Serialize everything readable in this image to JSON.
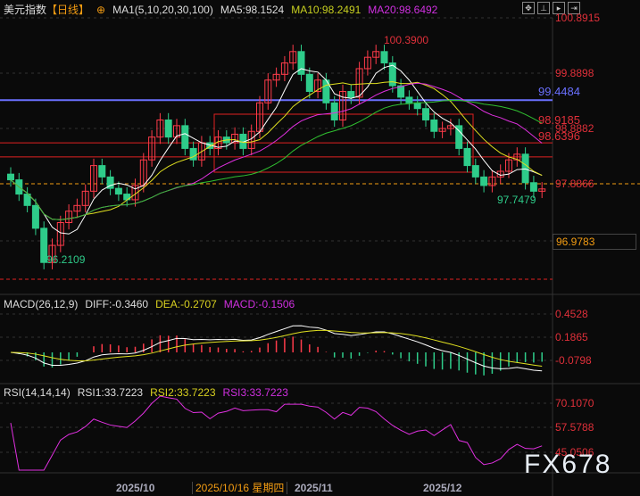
{
  "header": {
    "title": "美元指数",
    "period": "【日线】",
    "ma_label": "MA1(5,10,20,30,100)",
    "ma5": "MA5:98.1524",
    "ma10": "MA10:98.2491",
    "ma20": "MA20:98.6492"
  },
  "macd_header": {
    "label": "MACD(26,12,9)",
    "diff": "DIFF:-0.3460",
    "dea": "DEA:-0.2707",
    "macd": "MACD:-0.1506"
  },
  "rsi_header": {
    "label": "RSI(14,14,14)",
    "rsi1": "RSI1:33.7223",
    "rsi2": "RSI2:33.7223",
    "rsi3": "RSI3:33.7223"
  },
  "price_axis": [
    "100.8915",
    "99.8898",
    "98.8882",
    "97.8866",
    "96.9783"
  ],
  "macd_axis": [
    "0.4528",
    "0.1865",
    "-0.0798"
  ],
  "rsi_axis": [
    "70.1070",
    "57.5788",
    "45.0506"
  ],
  "x_axis": [
    "2025/10",
    "2025/11",
    "2025/12"
  ],
  "crosshair_date": "2025/10/16 星期四",
  "annotations": {
    "high": "100.3900",
    "low": "96.2109",
    "recent_low": "97.7479",
    "blue_line": "99.4484",
    "red_line1": "98.9185",
    "red_line2": "98.6396"
  },
  "levels": {
    "blue": 99.4484,
    "red1": 98.9185,
    "red2": 98.6396,
    "current": 97.8866
  },
  "watermark": "FX678",
  "colors": {
    "up": "#ff3b4a",
    "down": "#2ecc8a",
    "ma5": "#ffffff",
    "ma10": "#e0e020",
    "ma20": "#e030e0",
    "ma30": "#30c030",
    "blue": "#6a70ff"
  },
  "closes": [
    98.05,
    97.8,
    97.6,
    97.2,
    96.6,
    96.9,
    97.3,
    97.5,
    97.6,
    97.85,
    98.3,
    98.1,
    97.9,
    97.8,
    97.7,
    97.95,
    98.4,
    98.8,
    99.1,
    98.8,
    99.0,
    98.6,
    98.4,
    98.7,
    98.6,
    98.8,
    98.7,
    98.85,
    98.6,
    98.9,
    99.4,
    99.8,
    99.9,
    100.1,
    100.3,
    99.9,
    99.6,
    99.8,
    99.4,
    99.1,
    99.6,
    99.5,
    100.0,
    100.2,
    100.3,
    100.1,
    99.7,
    99.5,
    99.4,
    99.3,
    99.1,
    98.9,
    98.95,
    99.0,
    98.6,
    98.3,
    98.1,
    97.95,
    98.1,
    98.2,
    98.4,
    98.5,
    98.0,
    97.85,
    97.89
  ]
}
